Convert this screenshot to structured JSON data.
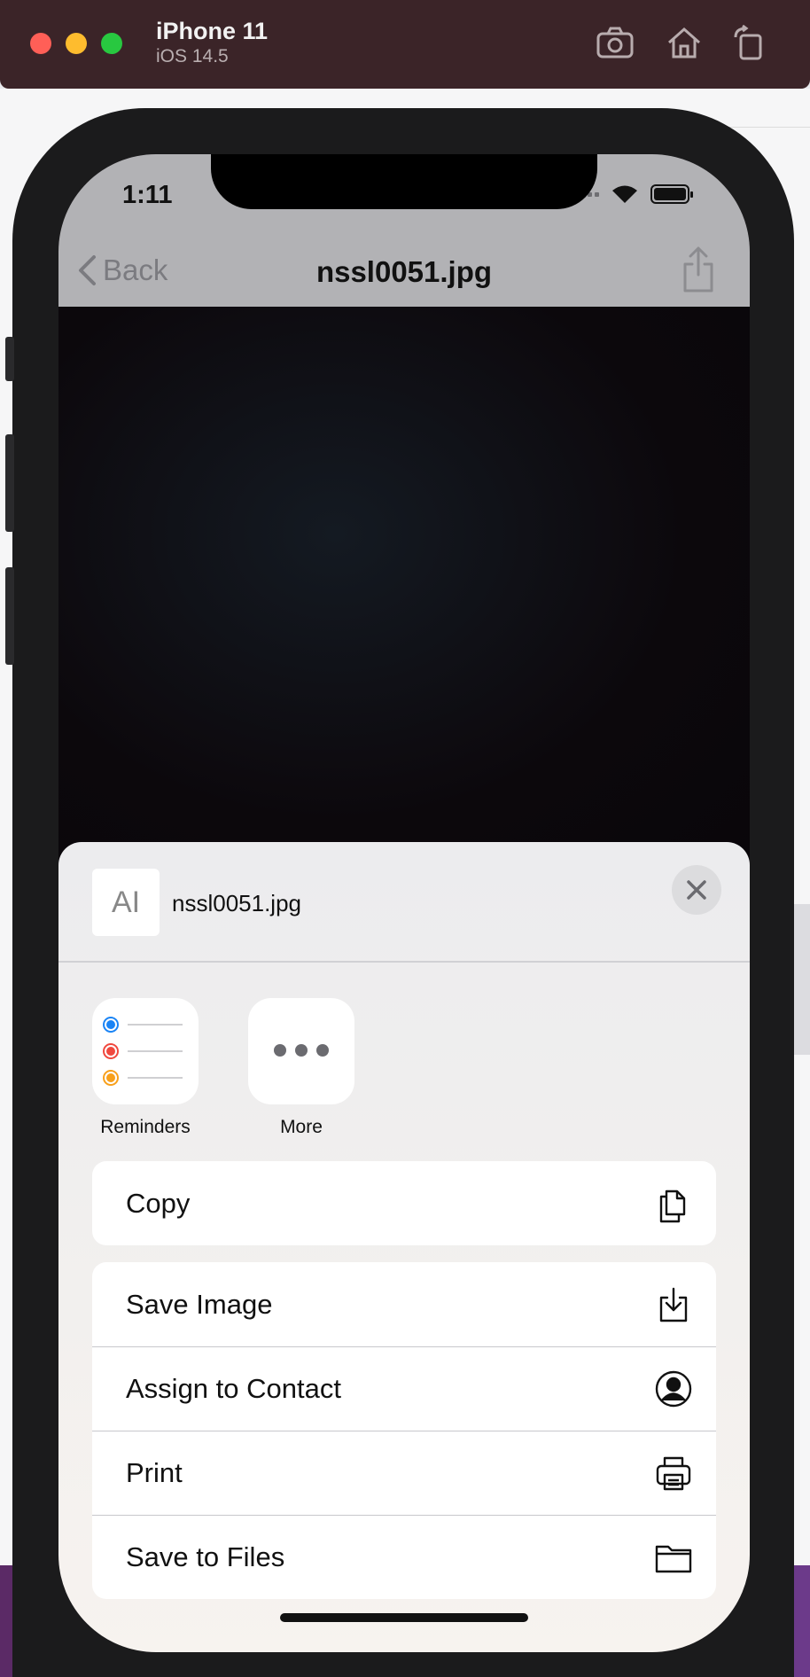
{
  "simulator": {
    "device_name": "iPhone 11",
    "os_version": "iOS 14.5",
    "toolbar": [
      "camera-icon",
      "home-icon",
      "rotate-icon"
    ]
  },
  "status_bar": {
    "time": "1:11"
  },
  "nav_bar": {
    "back_label": "Back",
    "title": "nssl0051.jpg"
  },
  "share_sheet": {
    "file_name": "nssl0051.jpg",
    "thumb_glyph": "AI",
    "apps": [
      {
        "label": "Reminders",
        "icon": "reminders-icon"
      },
      {
        "label": "More",
        "icon": "more-icon"
      }
    ],
    "actions_top": [
      {
        "label": "Copy",
        "icon": "copy-icon"
      }
    ],
    "actions": [
      {
        "label": "Save Image",
        "icon": "save-image-icon"
      },
      {
        "label": "Assign to Contact",
        "icon": "contact-icon"
      },
      {
        "label": "Print",
        "icon": "print-icon"
      },
      {
        "label": "Save to Files",
        "icon": "folder-icon"
      }
    ]
  },
  "colors": {
    "reminder_blue": "#1a84f5",
    "reminder_red": "#f0483e",
    "reminder_orange": "#f8a01b",
    "sim_bar": "#3b2428"
  }
}
